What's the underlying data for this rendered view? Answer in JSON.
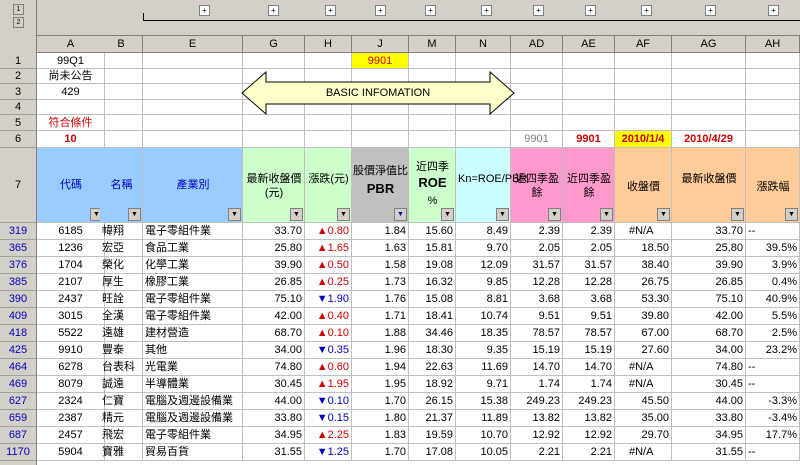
{
  "outline_levels": [
    "1",
    "2"
  ],
  "columns": [
    "A",
    "B",
    "E",
    "G",
    "H",
    "J",
    "M",
    "N",
    "AD",
    "AE",
    "AF",
    "AG",
    "AH"
  ],
  "top_rows": [
    "1",
    "2",
    "3",
    "4",
    "5",
    "6",
    "7"
  ],
  "cells": {
    "a1": "99Q1",
    "a2": "尚未公告",
    "a3": "429",
    "a5": "符合條件",
    "a6": "10",
    "j1": "9901",
    "ad6": "9901",
    "ae6": "9901",
    "af6": "2010/1/4",
    "ag6": "2010/4/29"
  },
  "banner": "BASIC INFOMATION",
  "headers": {
    "code": "代碼",
    "name": "名稱",
    "industry": "產業別",
    "close": "最新收盤價(元)",
    "change": "漲跌(元)",
    "pbr_top": "股價淨值比",
    "pbr": "PBR",
    "roe_top": "近四季",
    "roe": "ROE",
    "roe_unit": "%",
    "kn": "Kn=ROE/PBR",
    "ad": "近四季盈餘",
    "ae": "近四季盈餘",
    "af": "收盤價",
    "ag": "最新收盤價",
    "ah": "漲跌幅"
  },
  "colors": {
    "yellow": "#ffff00",
    "header_blue": "#99ccff",
    "header_green": "#ccffcc",
    "header_pink": "#ff99cc",
    "header_cyan": "#ccffff",
    "header_gray": "#c0c0c0",
    "header_tan": "#ffcc99",
    "red": "#d00000",
    "blue": "#0000c0"
  },
  "rows": [
    {
      "r": "319",
      "code": "6185",
      "name": "幃翔",
      "ind": "電子零組件業",
      "close": "33.70",
      "dir": "up",
      "chg": "0.80",
      "pbr": "1.84",
      "roe": "15.60",
      "kn": "8.49",
      "ad": "2.39",
      "ae": "2.39",
      "af": "#N/A",
      "ag": "33.70",
      "ah": "--",
      "tri": false
    },
    {
      "r": "365",
      "code": "1236",
      "name": "宏亞",
      "ind": "食品工業",
      "close": "25.80",
      "dir": "up",
      "chg": "1.65",
      "pbr": "1.63",
      "roe": "15.81",
      "kn": "9.70",
      "ad": "2.05",
      "ae": "2.05",
      "af": "18.50",
      "ag": "25.80",
      "ah": "39.5%",
      "tri": false
    },
    {
      "r": "376",
      "code": "1704",
      "name": "榮化",
      "ind": "化學工業",
      "close": "39.90",
      "dir": "up",
      "chg": "0.50",
      "pbr": "1.58",
      "roe": "19.08",
      "kn": "12.09",
      "ad": "31.57",
      "ae": "31.57",
      "af": "38.40",
      "ag": "39.90",
      "ah": "3.9%",
      "tri": false
    },
    {
      "r": "385",
      "code": "2107",
      "name": "厚生",
      "ind": "橡膠工業",
      "close": "26.85",
      "dir": "up",
      "chg": "0.25",
      "pbr": "1.73",
      "roe": "16.32",
      "kn": "9.85",
      "ad": "12.28",
      "ae": "12.28",
      "af": "26.75",
      "ag": "26.85",
      "ah": "0.4%",
      "tri": false
    },
    {
      "r": "390",
      "code": "2437",
      "name": "旺詮",
      "ind": "電子零組件業",
      "close": "75.10",
      "dir": "down",
      "chg": "1.90",
      "pbr": "1.76",
      "roe": "15.08",
      "kn": "8.81",
      "ad": "3.68",
      "ae": "3.68",
      "af": "53.30",
      "ag": "75.10",
      "ah": "40.9%",
      "tri": false
    },
    {
      "r": "409",
      "code": "3015",
      "name": "全漢",
      "ind": "電子零組件業",
      "close": "42.00",
      "dir": "up",
      "chg": "0.40",
      "pbr": "1.71",
      "roe": "18.41",
      "kn": "10.74",
      "ad": "9.51",
      "ae": "9.51",
      "af": "39.80",
      "ag": "42.00",
      "ah": "5.5%",
      "tri": false
    },
    {
      "r": "418",
      "code": "5522",
      "name": "遠雄",
      "ind": "建材營造",
      "close": "68.70",
      "dir": "up",
      "chg": "0.10",
      "pbr": "1.88",
      "roe": "34.46",
      "kn": "18.35",
      "ad": "78.57",
      "ae": "78.57",
      "af": "67.00",
      "ag": "68.70",
      "ah": "2.5%",
      "tri": false
    },
    {
      "r": "425",
      "code": "9910",
      "name": "豐泰",
      "ind": "其他",
      "close": "34.00",
      "dir": "down",
      "chg": "0.35",
      "pbr": "1.96",
      "roe": "18.30",
      "kn": "9.35",
      "ad": "15.19",
      "ae": "15.19",
      "af": "27.60",
      "ag": "34.00",
      "ah": "23.2%",
      "tri": false
    },
    {
      "r": "464",
      "code": "6278",
      "name": "台表科",
      "ind": "光電業",
      "close": "74.80",
      "dir": "up",
      "chg": "0.60",
      "pbr": "1.94",
      "roe": "22.63",
      "kn": "11.69",
      "ad": "14.70",
      "ae": "14.70",
      "af": "#N/A",
      "ag": "74.80",
      "ah": "--",
      "tri": true
    },
    {
      "r": "469",
      "code": "8079",
      "name": "誠遠",
      "ind": "半導體業",
      "close": "30.45",
      "dir": "up",
      "chg": "1.95",
      "pbr": "1.95",
      "roe": "18.92",
      "kn": "9.71",
      "ad": "1.74",
      "ae": "1.74",
      "af": "#N/A",
      "ag": "30.45",
      "ah": "--",
      "tri": true
    },
    {
      "r": "627",
      "code": "2324",
      "name": "仁寶",
      "ind": "電腦及週邊設備業",
      "close": "44.00",
      "dir": "down",
      "chg": "0.10",
      "pbr": "1.70",
      "roe": "26.15",
      "kn": "15.38",
      "ad": "249.23",
      "ae": "249.23",
      "af": "45.50",
      "ag": "44.00",
      "ah": "-3.3%",
      "tri": false
    },
    {
      "r": "659",
      "code": "2387",
      "name": "精元",
      "ind": "電腦及週邊設備業",
      "close": "33.80",
      "dir": "down",
      "chg": "0.15",
      "pbr": "1.80",
      "roe": "21.37",
      "kn": "11.89",
      "ad": "13.82",
      "ae": "13.82",
      "af": "35.00",
      "ag": "33.80",
      "ah": "-3.4%",
      "tri": false
    },
    {
      "r": "687",
      "code": "2457",
      "name": "飛宏",
      "ind": "電子零組件業",
      "close": "34.95",
      "dir": "up",
      "chg": "2.25",
      "pbr": "1.83",
      "roe": "19.59",
      "kn": "10.70",
      "ad": "12.92",
      "ae": "12.92",
      "af": "29.70",
      "ag": "34.95",
      "ah": "17.7%",
      "tri": false
    },
    {
      "r": "1170",
      "code": "5904",
      "name": "寶雅",
      "ind": "貿易百貨",
      "close": "31.55",
      "dir": "down",
      "chg": "1.25",
      "pbr": "1.70",
      "roe": "17.08",
      "kn": "10.05",
      "ad": "2.21",
      "ae": "2.21",
      "af": "#N/A",
      "ag": "31.55",
      "ah": "--",
      "tri": true
    }
  ]
}
